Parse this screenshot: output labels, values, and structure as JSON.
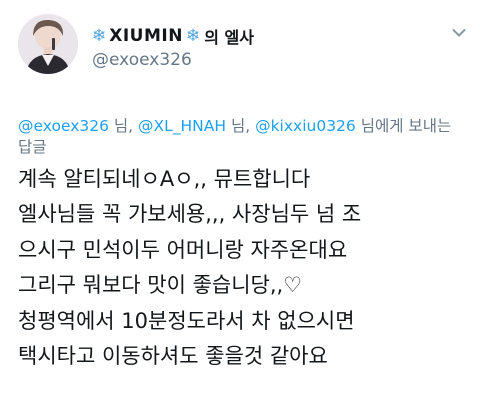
{
  "author": {
    "display_name": "XIUMIN",
    "snowflake_left": "❄",
    "snowflake_right": "❄",
    "name_suffix": "의 엘사",
    "handle": "@exoex326"
  },
  "reply_context": {
    "mention_1": "@exoex326",
    "sep_1": " 님, ",
    "mention_2": "@XL_HNAH",
    "sep_2": " 님, ",
    "mention_3": "@kixxiu0326",
    "tail": " 님에게 보내는 답글"
  },
  "tweet_lines": [
    "계속 알티되네ㅇAㅇ,, 뮤트합니다",
    "엘사님들 꼭 가보세용,,, 사장님두 넘 조",
    "으시구 민석이두 어머니랑 자주온대요",
    "그리구 뭐보다 맛이 좋습니당,,♡",
    "청평역에서 10분정도라서 차 없으시면",
    "택시타고 이동하셔도 좋을것 같아요"
  ],
  "icons": {
    "avatar": "profile-photo",
    "menu": "chevron-down-icon"
  },
  "colors": {
    "link": "#1da1f2",
    "muted": "#657786",
    "text": "#14171a",
    "snowflake": "#4fa3e0"
  }
}
